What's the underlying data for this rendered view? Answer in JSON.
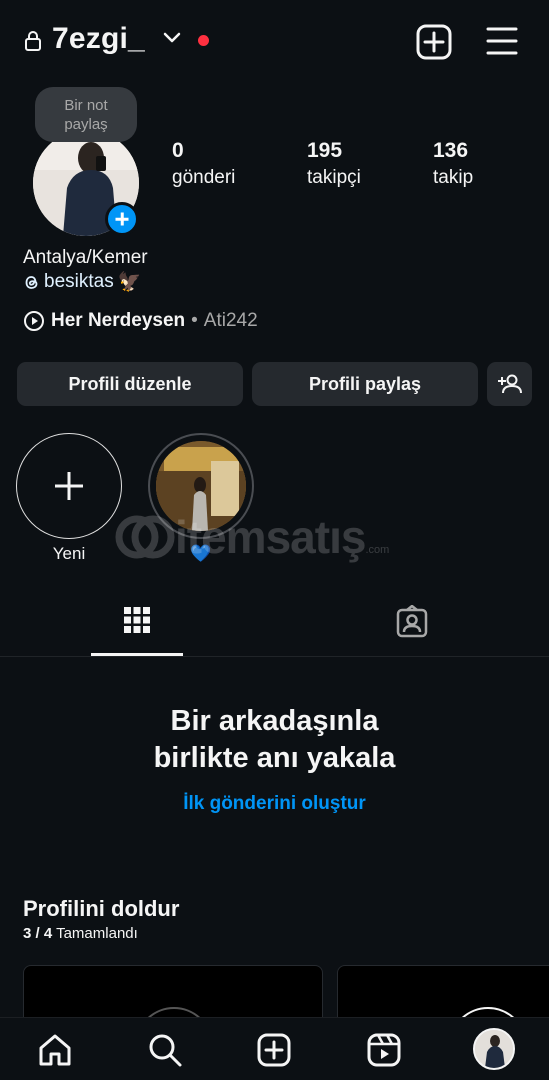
{
  "header": {
    "username": "7ezgi_",
    "notification_dot_color": "#ff3040"
  },
  "note": {
    "text_line1": "Bir not",
    "text_line2": "paylaş"
  },
  "stats": {
    "posts": {
      "count": "0",
      "label": "gönderi"
    },
    "followers": {
      "count": "195",
      "label": "takipçi"
    },
    "following": {
      "count": "136",
      "label": "takip"
    }
  },
  "bio": {
    "location": "Antalya/Kemer",
    "threads_handle": "besiktas",
    "emoji": "🦅"
  },
  "music": {
    "song": "Her Nerdeysen",
    "separator": "•",
    "artist": "Ati242"
  },
  "buttons": {
    "edit_profile": "Profili düzenle",
    "share_profile": "Profili paylaş"
  },
  "highlights": [
    {
      "label": "Yeni"
    },
    {
      "label": "💙"
    }
  ],
  "watermark": {
    "brand": "itemsatış",
    "suffix": ".com"
  },
  "empty_state": {
    "title_line1": "Bir arkadaşınla",
    "title_line2": "birlikte anı yakala",
    "cta": "İlk gönderini oluştur"
  },
  "profile_completion": {
    "title": "Profilini doldur",
    "progress": "3 / 4",
    "status": "Tamamlandı"
  },
  "colors": {
    "background": "#0c1014",
    "button_bg": "#25292e",
    "accent_blue": "#0095f6"
  }
}
